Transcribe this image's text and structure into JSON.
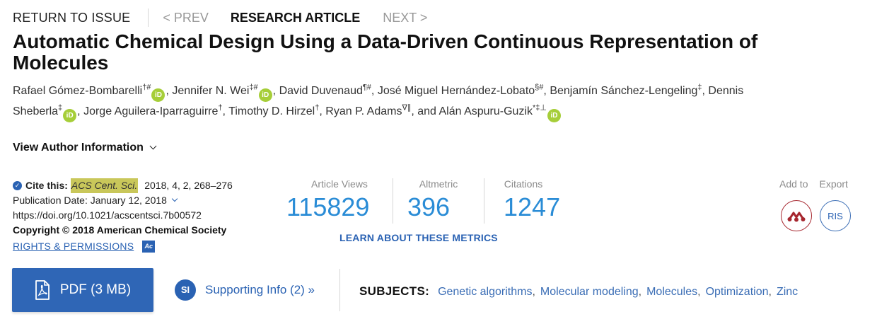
{
  "nav": {
    "return": "RETURN TO ISSUE",
    "prev": "< PREV",
    "article_type": "RESEARCH ARTICLE",
    "next": "NEXT >"
  },
  "title": "Automatic Chemical Design Using a Data-Driven Continuous Representation of Molecules",
  "authors": [
    {
      "name": "Rafael Gómez-Bombarelli",
      "sup": "†#",
      "orcid": true,
      "sep": ","
    },
    {
      "name": "Jennifer N. Wei",
      "sup": "‡#",
      "orcid": true,
      "sep": ","
    },
    {
      "name": "David Duvenaud",
      "sup": "¶#",
      "orcid": false,
      "sep": ","
    },
    {
      "name": "José Miguel Hernández-Lobato",
      "sup": "§#",
      "orcid": false,
      "sep": ","
    },
    {
      "name": "Benjamín Sánchez-Lengeling",
      "sup": "‡",
      "orcid": false,
      "sep": ","
    },
    {
      "name": "Dennis Sheberla",
      "sup": "‡",
      "orcid": true,
      "sep": ","
    },
    {
      "name": "Jorge Aguilera-Iparraguirre",
      "sup": "†",
      "orcid": false,
      "sep": ","
    },
    {
      "name": "Timothy D. Hirzel",
      "sup": "†",
      "orcid": false,
      "sep": ","
    },
    {
      "name": "Ryan P. Adams",
      "sup": "∇∥",
      "orcid": false,
      "sep": ", and"
    },
    {
      "name": "Alán Aspuru-Guzik",
      "sup": "*‡⊥",
      "orcid": true,
      "sep": ""
    }
  ],
  "orcid_label": "iD",
  "view_author": "View Author Information",
  "cite": {
    "label": "Cite this:",
    "journal": "ACS Cent. Sci.",
    "details": "2018, 4, 2, 268–276",
    "pub_date": "Publication Date: January 12, 2018",
    "doi": "https://doi.org/10.1021/acscentsci.7b00572",
    "copyright": "Copyright © 2018 American Chemical Society",
    "rights": "RIGHTS & PERMISSIONS",
    "rights_icon": "Ac"
  },
  "metrics": {
    "views_label": "Article Views",
    "views": "115829",
    "altmetric_label": "Altmetric",
    "altmetric": "396",
    "citations_label": "Citations",
    "citations": "1247",
    "learn": "LEARN ABOUT THESE METRICS"
  },
  "tools": {
    "add_to": "Add to",
    "export": "Export",
    "ris": "RIS",
    "icons": [
      "mendeley-icon"
    ]
  },
  "pdf": {
    "label": "PDF (3 MB)",
    "icon": "pdf-file-icon"
  },
  "supporting": {
    "badge": "SI",
    "label": "Supporting Info (2) »"
  },
  "subjects": {
    "label": "SUBJECTS:",
    "items": [
      "Genetic algorithms",
      "Molecular modeling",
      "Molecules",
      "Optimization",
      "Zinc"
    ]
  },
  "colors": {
    "link_blue": "#2a62b3",
    "metric_blue": "#2a8cd6",
    "orcid_green": "#a6ce39",
    "mendeley_red": "#a6262e",
    "journal_highlight": "#c9c75a"
  }
}
